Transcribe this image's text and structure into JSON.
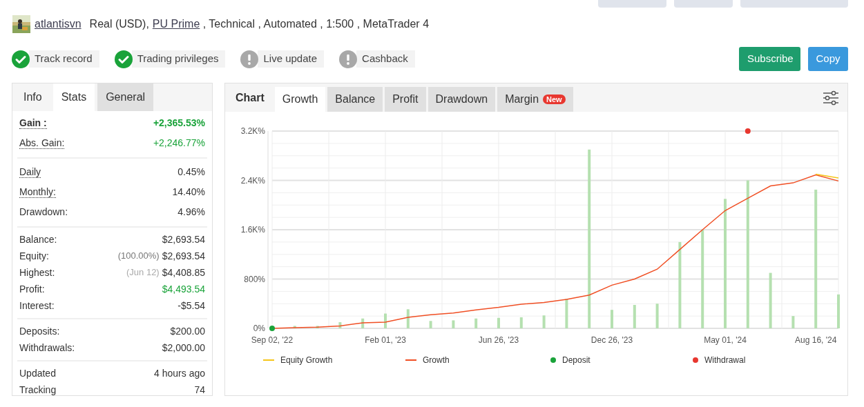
{
  "top_buttons": [
    {
      "kind": "cut"
    },
    {
      "kind": "cut"
    },
    {
      "kind": "cut"
    }
  ],
  "account": {
    "user": "atlantisvn",
    "type": "Real (USD),",
    "broker": "PU Prime",
    "details": ", Technical , Automated , 1:500 , MetaTrader 4"
  },
  "badges": [
    {
      "label": "Track record",
      "verified": true
    },
    {
      "label": "Trading privileges",
      "verified": true
    },
    {
      "label": "Live update",
      "verified": false
    },
    {
      "label": "Cashback",
      "verified": false
    }
  ],
  "actions": [
    {
      "label": "Subscribe",
      "kind": "primary"
    },
    {
      "label": "Copy",
      "kind": "secondary"
    }
  ],
  "stats_panel": {
    "header": "Info",
    "tabs": [
      {
        "label": "Stats",
        "selected": true
      },
      {
        "label": "General",
        "selected": false
      }
    ],
    "groups": [
      [
        {
          "label": "Gain :",
          "value": "+2,365.53%",
          "positive": true,
          "hint": true,
          "bold": true
        },
        {
          "label": "Abs. Gain:",
          "value": "+2,246.77%",
          "positive": true,
          "hint": true,
          "bold": false
        }
      ],
      [
        {
          "label": "Daily",
          "value": "0.45%",
          "positive": false,
          "hint": true,
          "bold": false
        },
        {
          "label": "Monthly:",
          "value": "14.40%",
          "positive": false,
          "hint": true,
          "bold": false
        },
        {
          "label": "Drawdown:",
          "value": "4.96%",
          "positive": false,
          "hint": false,
          "bold": false
        }
      ],
      [
        {
          "label": "Balance:",
          "value": "$2,693.54",
          "positive": false,
          "hint": false,
          "bold": false
        },
        {
          "label": "Equity:",
          "note": "(100.00%)",
          "value": "$2,693.54",
          "positive": false,
          "hint": false,
          "bold": false
        },
        {
          "label": "Highest:",
          "note": "(Jun 12)",
          "value": "$4,408.85",
          "positive": false,
          "hint": false,
          "bold": false
        },
        {
          "label": "Profit:",
          "value": "$4,493.54",
          "positive": true,
          "hint": false,
          "bold": false
        },
        {
          "label": "Interest:",
          "value": "-$5.54",
          "positive": false,
          "hint": false,
          "bold": false
        }
      ],
      [
        {
          "label": "Deposits:",
          "value": "$200.00",
          "positive": false,
          "hint": false,
          "bold": false
        },
        {
          "label": "Withdrawals:",
          "value": "$2,000.00",
          "positive": false,
          "hint": false,
          "bold": false
        }
      ],
      [
        {
          "label": "Updated",
          "value": "4 hours ago",
          "positive": false,
          "hint": false,
          "bold": false
        },
        {
          "label": "Tracking",
          "value": "74",
          "positive": false,
          "hint": false,
          "bold": false
        }
      ]
    ]
  },
  "chart_panel": {
    "header": "Chart",
    "tabs": [
      {
        "label": "Growth",
        "selected": true
      },
      {
        "label": "Balance",
        "selected": false
      },
      {
        "label": "Profit",
        "selected": false
      },
      {
        "label": "Drawdown",
        "selected": false
      },
      {
        "label": "Margin",
        "selected": false,
        "badge": "New"
      }
    ],
    "chart_data": {
      "type": "line",
      "categories": [
        "Sep 02, '22",
        null,
        null,
        null,
        null,
        "Feb 01, '23",
        null,
        null,
        null,
        null,
        "Jun 26, '23",
        null,
        null,
        null,
        null,
        "Dec 26, '23",
        null,
        null,
        null,
        null,
        "May 01, '24",
        null,
        null,
        null,
        "Aug 16, '24",
        null
      ],
      "ylim": [
        0,
        3200
      ],
      "grid": true,
      "yticks": [
        {
          "value": 0,
          "label": "0%"
        },
        {
          "value": 800,
          "label": "800%"
        },
        {
          "value": 1600,
          "label": "1.6K%"
        },
        {
          "value": 2400,
          "label": "2.4K%"
        },
        {
          "value": 3200,
          "label": "3.2K%"
        }
      ],
      "series": [
        {
          "name": "Equity Growth",
          "color": "#f5c518",
          "values": [
            null,
            null,
            null,
            null,
            null,
            null,
            null,
            null,
            null,
            null,
            null,
            null,
            null,
            null,
            null,
            null,
            null,
            null,
            null,
            null,
            null,
            null,
            null,
            null,
            2500,
            2440
          ]
        },
        {
          "name": "Growth",
          "color": "#f04e23",
          "values": [
            0,
            10,
            20,
            40,
            90,
            100,
            180,
            220,
            250,
            300,
            340,
            390,
            420,
            470,
            540,
            700,
            800,
            960,
            1280,
            1600,
            1910,
            2110,
            2310,
            2360,
            2490,
            2390
          ]
        },
        {
          "name": "Deposit",
          "color": "#1aa33a",
          "marker": true,
          "values": [
            0,
            null,
            null,
            null,
            null,
            null,
            null,
            null,
            null,
            null,
            null,
            null,
            null,
            null,
            null,
            null,
            null,
            null,
            null,
            null,
            null,
            null,
            null,
            null,
            null,
            null
          ]
        },
        {
          "name": "Withdrawal",
          "color": "#e8372f",
          "marker": true,
          "values": [
            null,
            null,
            null,
            null,
            null,
            null,
            null,
            null,
            null,
            null,
            null,
            null,
            null,
            null,
            null,
            null,
            null,
            null,
            null,
            null,
            null,
            3200,
            null,
            null,
            null,
            null
          ]
        }
      ]
    },
    "columns": {
      "chart_data": {
        "type": "bar",
        "ylim": [
          0,
          3200
        ],
        "series": [
          {
            "color": "#b5e0b0",
            "values": [
              0,
              40,
              40,
              100,
              160,
              240,
              310,
              120,
              130,
              160,
              170,
              180,
              210,
              480,
              2900,
              300,
              380,
              400,
              1400,
              1600,
              2100,
              2400,
              900,
              200,
              2250,
              550
            ]
          }
        ]
      }
    }
  }
}
